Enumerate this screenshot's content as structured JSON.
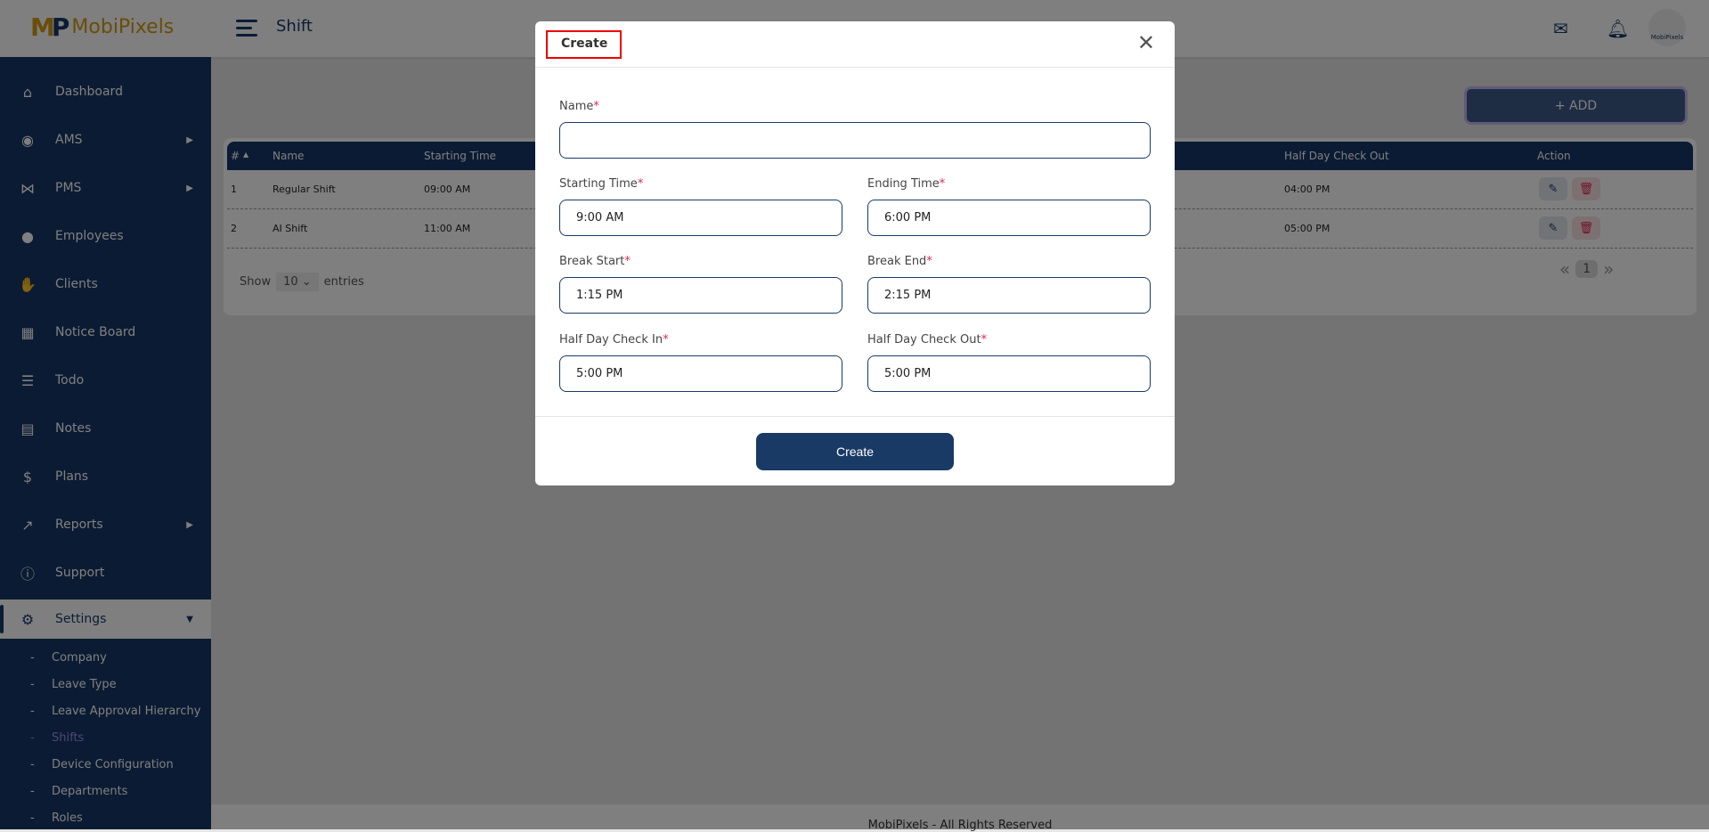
{
  "header": {
    "brand": "MobiPixels",
    "title": "Shift",
    "avatar_text": "MobiPixels",
    "icons": [
      "mail-icon",
      "bell-icon"
    ]
  },
  "sidebar": {
    "items": [
      {
        "label": "Dashboard",
        "icon": "home-icon"
      },
      {
        "label": "AMS",
        "icon": "fingerprint-icon",
        "arrow": true
      },
      {
        "label": "PMS",
        "icon": "bezier-icon",
        "arrow": true
      },
      {
        "label": "Employees",
        "icon": "user-icon"
      },
      {
        "label": "Clients",
        "icon": "handshake-icon"
      },
      {
        "label": "Notice Board",
        "icon": "calendar-icon"
      },
      {
        "label": "Todo",
        "icon": "checklist-icon"
      },
      {
        "label": "Notes",
        "icon": "file-icon"
      },
      {
        "label": "Plans",
        "icon": "dollar-icon"
      },
      {
        "label": "Reports",
        "icon": "chart-icon",
        "arrow": true
      },
      {
        "label": "Support",
        "icon": "info-icon"
      },
      {
        "label": "Settings",
        "icon": "gear-icon",
        "active": true
      }
    ],
    "sub_items": [
      "Company",
      "Leave Type",
      "Leave Approval Hierarchy",
      "Shifts",
      "Device Configuration",
      "Departments",
      "Roles"
    ],
    "active_sub": "Shifts"
  },
  "main": {
    "add_label": "+ ADD",
    "table": {
      "columns": [
        "#",
        "Name",
        "Starting Time",
        "Half Day Check Out",
        "Action"
      ],
      "rows": [
        {
          "id": "1",
          "name": "Regular Shift",
          "start": "09:00 AM",
          "half_out": "04:00 PM"
        },
        {
          "id": "2",
          "name": "AI Shift",
          "start": "11:00 AM",
          "half_out": "05:00 PM"
        }
      ]
    },
    "show_label": "Show",
    "entries_value": "10",
    "entries_label": "entries",
    "page": "1"
  },
  "footer": "MobiPixels - All Rights Reserved",
  "modal": {
    "title": "Create",
    "required": "*",
    "fields": [
      {
        "label": "Name",
        "value": ""
      },
      {
        "label": "Starting Time",
        "value": "9:00 AM"
      },
      {
        "label": "Ending Time",
        "value": "6:00 PM"
      },
      {
        "label": "Break Start",
        "value": "1:15 PM"
      },
      {
        "label": "Break End",
        "value": "2:15 PM"
      },
      {
        "label": "Half Day Check In",
        "value": "5:00 PM"
      },
      {
        "label": "Half Day Check Out",
        "value": "5:00 PM"
      }
    ],
    "submit": "Create"
  },
  "colors": {
    "primary": "#173a6b",
    "required": "#e0284f",
    "highlight": "#ff0000"
  }
}
